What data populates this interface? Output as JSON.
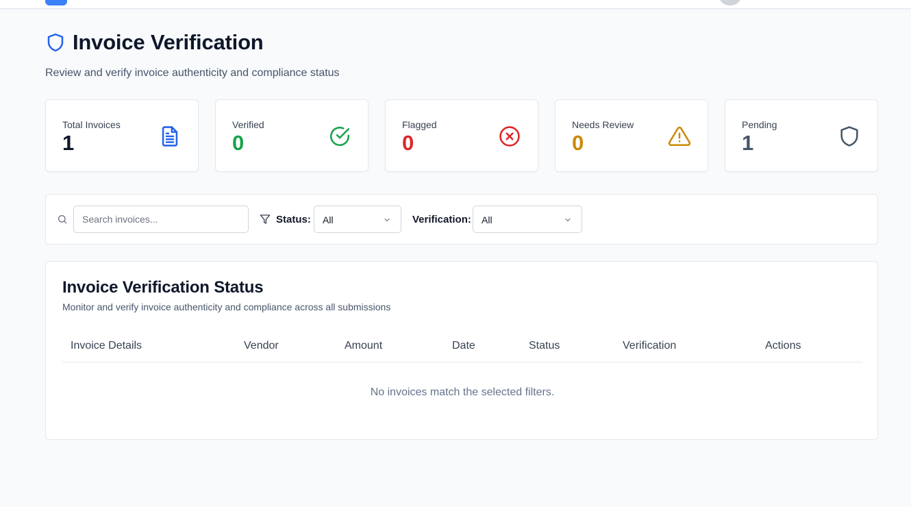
{
  "page": {
    "title": "Invoice Verification",
    "subtitle": "Review and verify invoice authenticity and compliance status"
  },
  "stats": [
    {
      "label": "Total Invoices",
      "value": "1",
      "color": "#0f172a",
      "icon": "document-icon",
      "icon_color": "#2563eb"
    },
    {
      "label": "Verified",
      "value": "0",
      "color": "#16a34a",
      "icon": "check-circle-icon",
      "icon_color": "#16a34a"
    },
    {
      "label": "Flagged",
      "value": "0",
      "color": "#dc2626",
      "icon": "x-circle-icon",
      "icon_color": "#dc2626"
    },
    {
      "label": "Needs Review",
      "value": "0",
      "color": "#ca8a04",
      "icon": "warning-triangle-icon",
      "icon_color": "#ca8a04"
    },
    {
      "label": "Pending",
      "value": "1",
      "color": "#475569",
      "icon": "shield-icon",
      "icon_color": "#475569"
    }
  ],
  "filters": {
    "search_placeholder": "Search invoices...",
    "status_label": "Status:",
    "status_value": "All",
    "verification_label": "Verification:",
    "verification_value": "All"
  },
  "table": {
    "title": "Invoice Verification Status",
    "subtitle": "Monitor and verify invoice authenticity and compliance across all submissions",
    "columns": [
      "Invoice Details",
      "Vendor",
      "Amount",
      "Date",
      "Status",
      "Verification",
      "Actions"
    ],
    "empty_message": "No invoices match the selected filters."
  },
  "colors": {
    "accent": "#2563eb",
    "background": "#f8fafc"
  }
}
